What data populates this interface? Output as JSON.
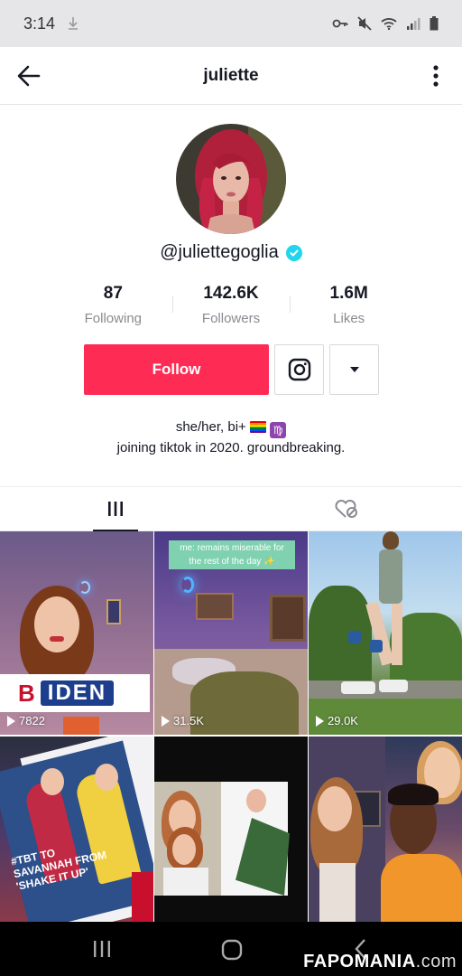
{
  "status_bar": {
    "time": "3:14"
  },
  "header": {
    "title": "juliette"
  },
  "profile": {
    "handle": "@juliettegoglia",
    "verified": true,
    "stats": [
      {
        "value": "87",
        "label": "Following"
      },
      {
        "value": "142.6K",
        "label": "Followers"
      },
      {
        "value": "1.6M",
        "label": "Likes"
      }
    ],
    "follow_label": "Follow",
    "bio_line1": "she/her, bi+",
    "bio_line2": "joining tiktok in 2020. groundbreaking.",
    "colors": {
      "follow_bg": "#fe2c55",
      "verified": "#20d5ec"
    }
  },
  "tabs": [
    {
      "name": "videos",
      "icon": "grid-icon",
      "active": true
    },
    {
      "name": "liked",
      "icon": "heart-lock-icon",
      "active": false
    }
  ],
  "videos": [
    {
      "views": "7822",
      "overlay_b": "B",
      "overlay_text": "IDEN"
    },
    {
      "views": "31.5K",
      "caption": "me: remains miserable for the rest of the day ✨"
    },
    {
      "views": "29.0K"
    },
    {
      "views": "",
      "overlay_text": "#TBT TO SAVANNAH FROM 'SHAKE IT UP'"
    },
    {
      "views": ""
    },
    {
      "views": ""
    }
  ],
  "watermark": {
    "main": "FAPOMANIA",
    "suffix": ".com"
  }
}
